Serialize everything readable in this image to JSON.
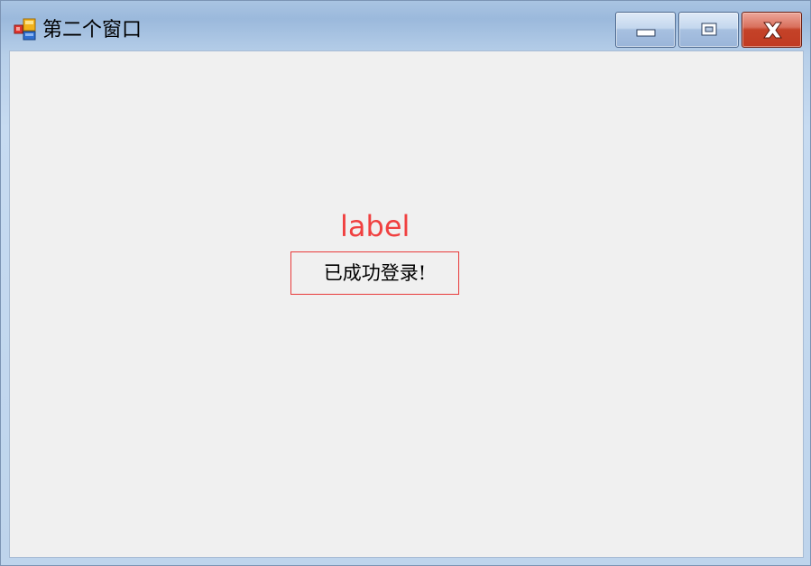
{
  "window": {
    "title": "第二个窗口",
    "controls": {
      "minimize_icon": "minimize-icon",
      "maximize_icon": "maximize-icon",
      "close_icon": "close-icon"
    },
    "colors": {
      "close_button": "#c13b22",
      "client_background": "#f0f0f0"
    }
  },
  "content": {
    "label_text": "label",
    "label_color": "#f04040",
    "status_text": "已成功登录!",
    "status_border_color": "#e83a3a"
  }
}
